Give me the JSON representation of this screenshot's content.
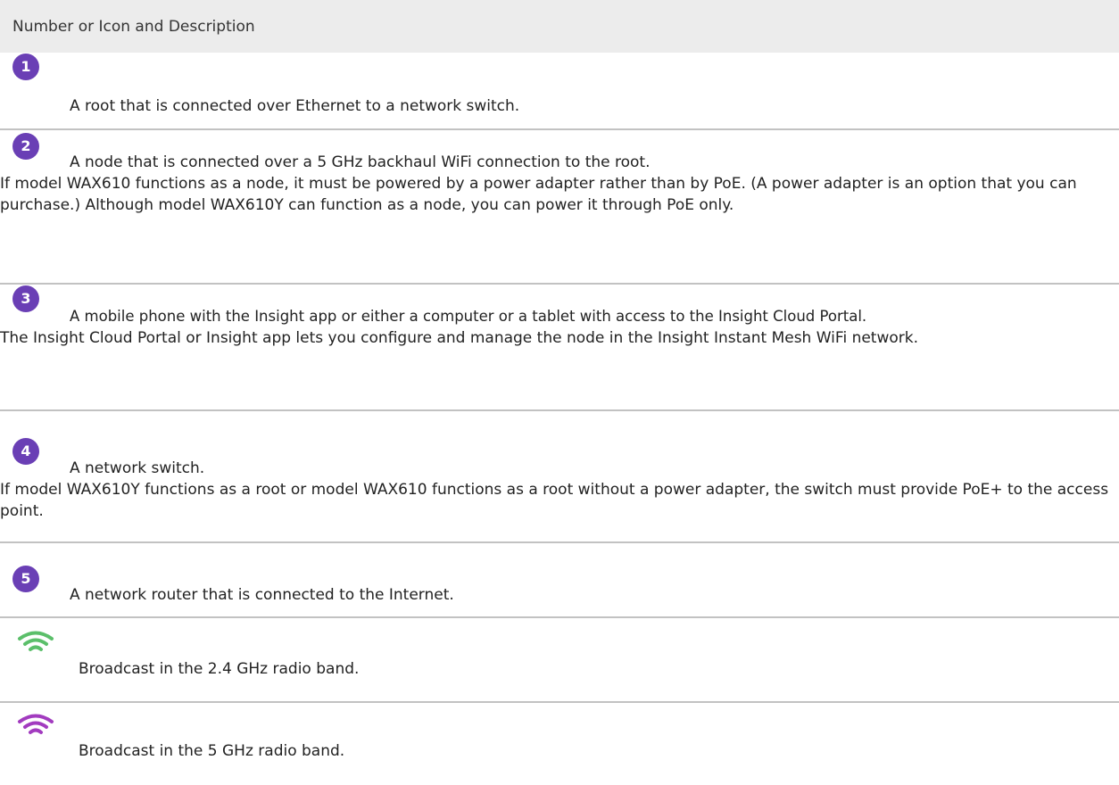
{
  "header": {
    "title": "Number or Icon and Description"
  },
  "rows": [
    {
      "badge": "1",
      "description": "A root that is connected over Ethernet to a network switch."
    },
    {
      "badge": "2",
      "description": "A node that is connected over a 5 GHz backhaul WiFi connection to the root.",
      "detail": "If model WAX610 functions as a node, it must be powered by a power adapter rather than by PoE. (A power adapter is an option that you can purchase.) Although model WAX610Y can function as a node, you can power it through PoE only."
    },
    {
      "badge": "3",
      "description": "A mobile phone with the Insight app or either a computer or a tablet with access to the Insight Cloud Portal.",
      "detail": "The Insight Cloud Portal or Insight app lets you configure and manage the node in the Insight Instant Mesh WiFi network."
    },
    {
      "badge": "4",
      "description": "A network switch.",
      "detail": "If model WAX610Y functions as a root or model WAX610 functions as a root without a power adapter, the switch must provide PoE+ to the access point."
    },
    {
      "badge": "5",
      "description": "A network router that is connected to the Internet."
    },
    {
      "icon": "wifi-green-icon",
      "description": "Broadcast in the 2.4 GHz radio band."
    },
    {
      "icon": "wifi-purple-icon",
      "description": "Broadcast in the 5 GHz radio band."
    }
  ],
  "colors": {
    "badge": "#6a3fb5",
    "wifi_24ghz": "#5bbf6a",
    "wifi_5ghz": "#a23bbf",
    "header_bg": "#ececec",
    "divider": "#c2c2c2"
  }
}
